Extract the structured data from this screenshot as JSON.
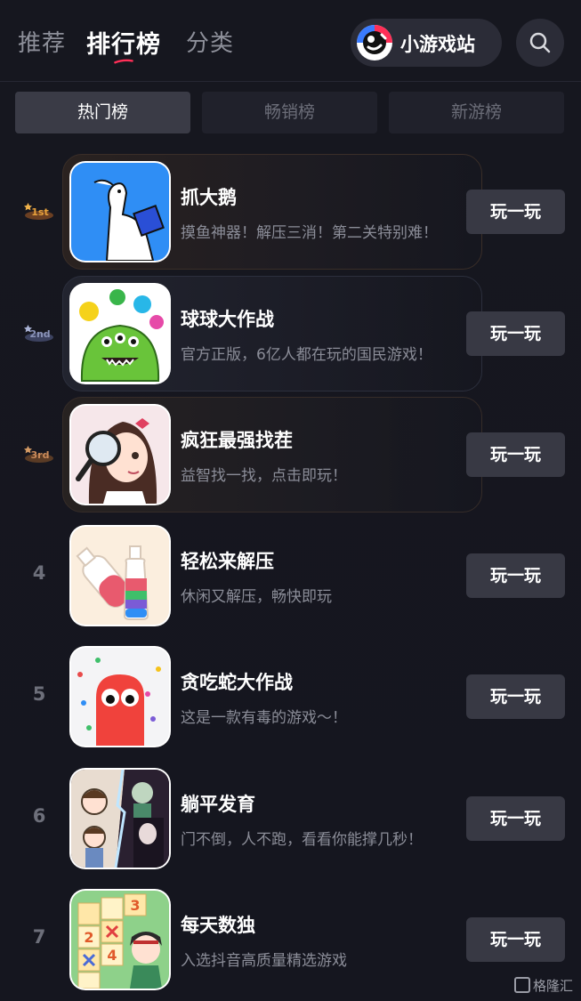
{
  "nav": {
    "tabs": [
      {
        "label": "推荐"
      },
      {
        "label": "排行榜"
      },
      {
        "label": "分类"
      }
    ],
    "mini_game_label": "小游戏站",
    "search_icon": "search-icon"
  },
  "segments": [
    {
      "label": "热门榜",
      "active": true
    },
    {
      "label": "畅销榜",
      "active": false
    },
    {
      "label": "新游榜",
      "active": false
    }
  ],
  "colors": {
    "background": "#16171f",
    "button": "#383944",
    "segment_active": "#3a3b46",
    "underline_accent": "#ff2f57",
    "medal_gold": "#e8a23c",
    "medal_silver": "#8a93b8",
    "medal_bronze": "#c98a5a"
  },
  "games": [
    {
      "rank": "1st",
      "title": "抓大鹅",
      "desc": "摸鱼神器！解压三消！第二关特别难！",
      "button": "玩一玩"
    },
    {
      "rank": "2nd",
      "title": "球球大作战",
      "desc": "官方正版，6亿人都在玩的国民游戏！",
      "button": "玩一玩"
    },
    {
      "rank": "3rd",
      "title": "疯狂最强找茬",
      "desc": "益智找一找，点击即玩！",
      "button": "玩一玩"
    },
    {
      "rank": "4",
      "title": "轻松来解压",
      "desc": "休闲又解压，畅快即玩",
      "button": "玩一玩"
    },
    {
      "rank": "5",
      "title": "贪吃蛇大作战",
      "desc": "这是一款有毒的游戏～！",
      "button": "玩一玩"
    },
    {
      "rank": "6",
      "title": "躺平发育",
      "desc": "门不倒，人不跑，看看你能撑几秒！",
      "button": "玩一玩"
    },
    {
      "rank": "7",
      "title": "每天数独",
      "desc": "入选抖音高质量精选游戏",
      "button": "玩一玩"
    }
  ],
  "watermark": "格隆汇"
}
